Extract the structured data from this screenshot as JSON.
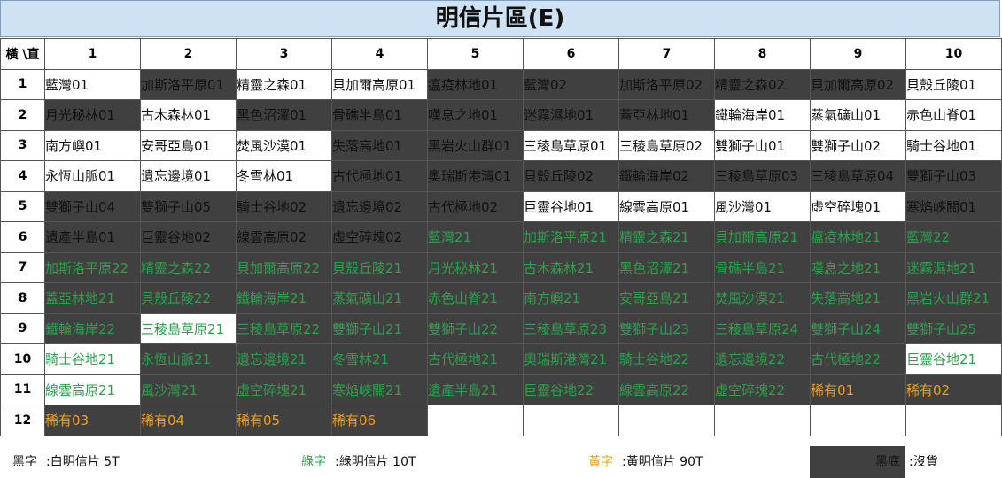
{
  "title": "明信片區(E)",
  "corner_header": "橫 \\直",
  "column_headers": [
    "1",
    "2",
    "3",
    "4",
    "5",
    "6",
    "7",
    "8",
    "9",
    "10"
  ],
  "row_headers": [
    "1",
    "2",
    "3",
    "4",
    "5",
    "6",
    "7",
    "8",
    "9",
    "10",
    "11",
    "12"
  ],
  "rows": [
    [
      {
        "t": "藍灣01",
        "bg": "w",
        "c": "k"
      },
      {
        "t": "加斯洛平原01",
        "bg": "d",
        "c": "k"
      },
      {
        "t": "精靈之森01",
        "bg": "w",
        "c": "k"
      },
      {
        "t": "貝加爾高原01",
        "bg": "w",
        "c": "k"
      },
      {
        "t": "瘟疫林地01",
        "bg": "d",
        "c": "k"
      },
      {
        "t": "藍灣02",
        "bg": "d",
        "c": "k"
      },
      {
        "t": "加斯洛平原02",
        "bg": "d",
        "c": "k"
      },
      {
        "t": "精靈之森02",
        "bg": "d",
        "c": "k"
      },
      {
        "t": "貝加爾高原02",
        "bg": "d",
        "c": "k"
      },
      {
        "t": "貝殼丘陵01",
        "bg": "w",
        "c": "k"
      }
    ],
    [
      {
        "t": "月光秘林01",
        "bg": "d",
        "c": "k"
      },
      {
        "t": "古木森林01",
        "bg": "w",
        "c": "k"
      },
      {
        "t": "黑色沼澤01",
        "bg": "d",
        "c": "k"
      },
      {
        "t": "骨礁半島01",
        "bg": "d",
        "c": "k"
      },
      {
        "t": "嘆息之地01",
        "bg": "d",
        "c": "k"
      },
      {
        "t": "迷霧濕地01",
        "bg": "d",
        "c": "k"
      },
      {
        "t": "蓋亞林地01",
        "bg": "d",
        "c": "k"
      },
      {
        "t": "鐵輪海岸01",
        "bg": "w",
        "c": "k"
      },
      {
        "t": "蒸氣礦山01",
        "bg": "w",
        "c": "k"
      },
      {
        "t": "赤色山脊01",
        "bg": "w",
        "c": "k"
      }
    ],
    [
      {
        "t": "南方嶼01",
        "bg": "w",
        "c": "k"
      },
      {
        "t": "安哥亞島01",
        "bg": "w",
        "c": "k"
      },
      {
        "t": "焚風沙漠01",
        "bg": "w",
        "c": "k"
      },
      {
        "t": "失落高地01",
        "bg": "d",
        "c": "k"
      },
      {
        "t": "黑岩火山群01",
        "bg": "d",
        "c": "k"
      },
      {
        "t": "三稜島草原01",
        "bg": "w",
        "c": "k"
      },
      {
        "t": "三稜島草原02",
        "bg": "w",
        "c": "k"
      },
      {
        "t": "雙獅子山01",
        "bg": "w",
        "c": "k"
      },
      {
        "t": "雙獅子山02",
        "bg": "w",
        "c": "k"
      },
      {
        "t": "騎士谷地01",
        "bg": "w",
        "c": "k"
      }
    ],
    [
      {
        "t": "永恆山脈01",
        "bg": "w",
        "c": "k"
      },
      {
        "t": "遺忘邊境01",
        "bg": "w",
        "c": "k"
      },
      {
        "t": "冬雪林01",
        "bg": "w",
        "c": "k"
      },
      {
        "t": "古代極地01",
        "bg": "d",
        "c": "k"
      },
      {
        "t": "奧瑞斯港灣01",
        "bg": "d",
        "c": "k"
      },
      {
        "t": "貝殼丘陵02",
        "bg": "d",
        "c": "k"
      },
      {
        "t": "鐵輪海岸02",
        "bg": "d",
        "c": "k"
      },
      {
        "t": "三稜島草原03",
        "bg": "d",
        "c": "k"
      },
      {
        "t": "三稜島草原04",
        "bg": "d",
        "c": "k"
      },
      {
        "t": "雙獅子山03",
        "bg": "d",
        "c": "k"
      }
    ],
    [
      {
        "t": "雙獅子山04",
        "bg": "d",
        "c": "k"
      },
      {
        "t": "雙獅子山05",
        "bg": "d",
        "c": "k"
      },
      {
        "t": "騎士谷地02",
        "bg": "d",
        "c": "k"
      },
      {
        "t": "遺忘邊境02",
        "bg": "d",
        "c": "k"
      },
      {
        "t": "古代極地02",
        "bg": "d",
        "c": "k"
      },
      {
        "t": "巨靈谷地01",
        "bg": "w",
        "c": "k"
      },
      {
        "t": "線雲高原01",
        "bg": "w",
        "c": "k"
      },
      {
        "t": "風沙灣01",
        "bg": "w",
        "c": "k"
      },
      {
        "t": "虛空碎塊01",
        "bg": "w",
        "c": "k"
      },
      {
        "t": "寒焰峽關01",
        "bg": "d",
        "c": "k"
      }
    ],
    [
      {
        "t": "遺產半島01",
        "bg": "d",
        "c": "k"
      },
      {
        "t": "巨靈谷地02",
        "bg": "d",
        "c": "k"
      },
      {
        "t": "線雲高原02",
        "bg": "d",
        "c": "k"
      },
      {
        "t": "虛空碎塊02",
        "bg": "d",
        "c": "k"
      },
      {
        "t": "藍灣21",
        "bg": "d",
        "c": "g"
      },
      {
        "t": "加斯洛平原21",
        "bg": "d",
        "c": "g"
      },
      {
        "t": "精靈之森21",
        "bg": "d",
        "c": "g"
      },
      {
        "t": "貝加爾高原21",
        "bg": "d",
        "c": "g"
      },
      {
        "t": "瘟疫林地21",
        "bg": "d",
        "c": "g"
      },
      {
        "t": "藍灣22",
        "bg": "d",
        "c": "g"
      }
    ],
    [
      {
        "t": "加斯洛平原22",
        "bg": "d",
        "c": "g"
      },
      {
        "t": "精靈之森22",
        "bg": "d",
        "c": "g"
      },
      {
        "t": "貝加爾高原22",
        "bg": "d",
        "c": "g"
      },
      {
        "t": "貝殼丘陵21",
        "bg": "d",
        "c": "g"
      },
      {
        "t": "月光秘林21",
        "bg": "d",
        "c": "g"
      },
      {
        "t": "古木森林21",
        "bg": "d",
        "c": "g"
      },
      {
        "t": "黑色沼澤21",
        "bg": "d",
        "c": "g"
      },
      {
        "t": "骨礁半島21",
        "bg": "d",
        "c": "g"
      },
      {
        "t": "嘆息之地21",
        "bg": "d",
        "c": "g"
      },
      {
        "t": "迷霧濕地21",
        "bg": "d",
        "c": "g"
      }
    ],
    [
      {
        "t": "蓋亞林地21",
        "bg": "d",
        "c": "g"
      },
      {
        "t": "貝殼丘陵22",
        "bg": "d",
        "c": "g"
      },
      {
        "t": "鐵輪海岸21",
        "bg": "d",
        "c": "g"
      },
      {
        "t": "蒸氣礦山21",
        "bg": "d",
        "c": "g"
      },
      {
        "t": "赤色山脊21",
        "bg": "d",
        "c": "g"
      },
      {
        "t": "南方嶼21",
        "bg": "d",
        "c": "g"
      },
      {
        "t": "安哥亞島21",
        "bg": "d",
        "c": "g"
      },
      {
        "t": "焚風沙漠21",
        "bg": "d",
        "c": "g"
      },
      {
        "t": "失落高地21",
        "bg": "d",
        "c": "g"
      },
      {
        "t": "黑岩火山群21",
        "bg": "d",
        "c": "g"
      }
    ],
    [
      {
        "t": "鐵輪海岸22",
        "bg": "d",
        "c": "g"
      },
      {
        "t": "三稜島草原21",
        "bg": "w",
        "c": "g"
      },
      {
        "t": "三稜島草原22",
        "bg": "d",
        "c": "g"
      },
      {
        "t": "雙獅子山21",
        "bg": "d",
        "c": "g"
      },
      {
        "t": "雙獅子山22",
        "bg": "d",
        "c": "g"
      },
      {
        "t": "三稜島草原23",
        "bg": "d",
        "c": "g"
      },
      {
        "t": "雙獅子山23",
        "bg": "d",
        "c": "g"
      },
      {
        "t": "三稜島草原24",
        "bg": "d",
        "c": "g"
      },
      {
        "t": "雙獅子山24",
        "bg": "d",
        "c": "g"
      },
      {
        "t": "雙獅子山25",
        "bg": "d",
        "c": "g"
      }
    ],
    [
      {
        "t": "騎士谷地21",
        "bg": "w",
        "c": "g"
      },
      {
        "t": "永恆山脈21",
        "bg": "d",
        "c": "g"
      },
      {
        "t": "遺忘邊境21",
        "bg": "d",
        "c": "g"
      },
      {
        "t": "冬雪林21",
        "bg": "d",
        "c": "g"
      },
      {
        "t": "古代極地21",
        "bg": "d",
        "c": "g"
      },
      {
        "t": "奧瑞斯港灣21",
        "bg": "d",
        "c": "g"
      },
      {
        "t": "騎士谷地22",
        "bg": "d",
        "c": "g"
      },
      {
        "t": "遺忘邊境22",
        "bg": "d",
        "c": "g"
      },
      {
        "t": "古代極地22",
        "bg": "d",
        "c": "g"
      },
      {
        "t": "巨靈谷地21",
        "bg": "w",
        "c": "g"
      }
    ],
    [
      {
        "t": "線雲高原21",
        "bg": "w",
        "c": "g"
      },
      {
        "t": "風沙灣21",
        "bg": "d",
        "c": "g"
      },
      {
        "t": "虛空碎塊21",
        "bg": "d",
        "c": "g"
      },
      {
        "t": "寒焰峽關21",
        "bg": "d",
        "c": "g"
      },
      {
        "t": "遺產半島21",
        "bg": "d",
        "c": "g"
      },
      {
        "t": "巨靈谷地22",
        "bg": "d",
        "c": "g"
      },
      {
        "t": "線雲高原22",
        "bg": "d",
        "c": "g"
      },
      {
        "t": "虛空碎塊22",
        "bg": "d",
        "c": "g"
      },
      {
        "t": "稀有01",
        "bg": "d",
        "c": "y"
      },
      {
        "t": "稀有02",
        "bg": "d",
        "c": "y"
      }
    ],
    [
      {
        "t": "稀有03",
        "bg": "d",
        "c": "y"
      },
      {
        "t": "稀有04",
        "bg": "d",
        "c": "y"
      },
      {
        "t": "稀有05",
        "bg": "d",
        "c": "y"
      },
      {
        "t": "稀有06",
        "bg": "d",
        "c": "y"
      },
      {
        "t": "",
        "bg": "e",
        "c": "k"
      },
      {
        "t": "",
        "bg": "e",
        "c": "k"
      },
      {
        "t": "",
        "bg": "e",
        "c": "k"
      },
      {
        "t": "",
        "bg": "e",
        "c": "k"
      },
      {
        "t": "",
        "bg": "e",
        "c": "k"
      },
      {
        "t": "",
        "bg": "e",
        "c": "k"
      }
    ]
  ],
  "legend": {
    "black_label": "黑字",
    "black_desc": ":白明信片 5T",
    "green_label": "綠字",
    "green_desc": ":綠明信片 10T",
    "yellow_label": "黃字",
    "yellow_desc": ":黃明信片 90T",
    "dark_label": "黑底",
    "dark_desc": ":沒貨"
  },
  "colors": {
    "dark_bg": "#404040",
    "green_text": "#2aa14b",
    "yellow_text": "#f0a01e",
    "title_bg": "#cfe2f3"
  }
}
